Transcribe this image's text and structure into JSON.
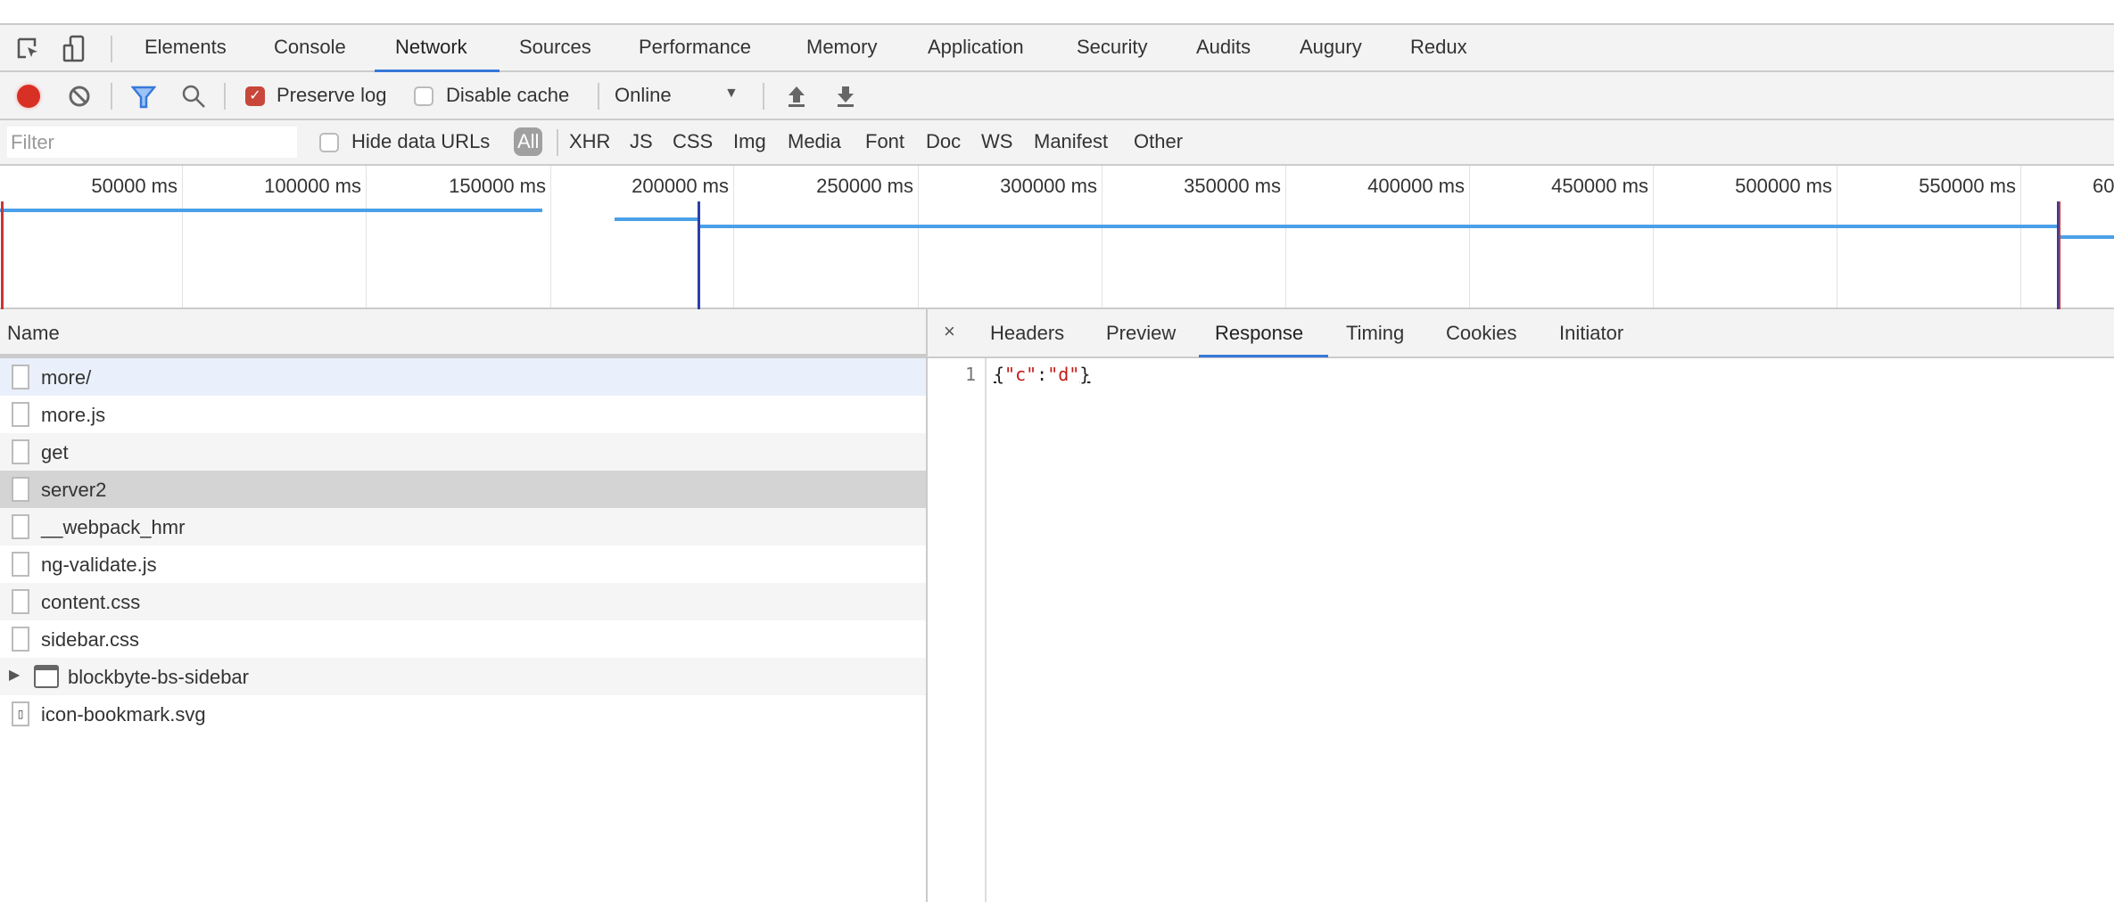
{
  "tabs": {
    "items": [
      "Elements",
      "Console",
      "Network",
      "Sources",
      "Performance",
      "Memory",
      "Application",
      "Security",
      "Audits",
      "Augury",
      "Redux"
    ],
    "active": "Network"
  },
  "toolbar": {
    "preserve_log": "Preserve log",
    "preserve_log_checked": true,
    "disable_cache": "Disable cache",
    "disable_cache_checked": false,
    "throttle": "Online",
    "record_color": "#d93025"
  },
  "filterbar": {
    "placeholder": "Filter",
    "hide_data_urls": "Hide data URLs",
    "types": [
      "All",
      "XHR",
      "JS",
      "CSS",
      "Img",
      "Media",
      "Font",
      "Doc",
      "WS",
      "Manifest",
      "Other"
    ],
    "active_type": "All"
  },
  "timeline": {
    "labels": [
      "50000 ms",
      "100000 ms",
      "150000 ms",
      "200000 ms",
      "250000 ms",
      "300000 ms",
      "350000 ms",
      "400000 ms",
      "450000 ms",
      "500000 ms",
      "550000 ms",
      "60"
    ]
  },
  "requests": {
    "header": "Name",
    "rows": [
      {
        "name": "more/",
        "icon": "document-icon"
      },
      {
        "name": "more.js",
        "icon": "script-icon"
      },
      {
        "name": "get",
        "icon": "file-icon"
      },
      {
        "name": "server2",
        "icon": "file-icon",
        "selected": true
      },
      {
        "name": "__webpack_hmr",
        "icon": "file-icon"
      },
      {
        "name": "ng-validate.js",
        "icon": "script-icon"
      },
      {
        "name": "content.css",
        "icon": "file-icon"
      },
      {
        "name": "sidebar.css",
        "icon": "file-icon"
      },
      {
        "name": "blockbyte-bs-sidebar",
        "icon": "frame-icon",
        "expandable": true
      },
      {
        "name": "icon-bookmark.svg",
        "icon": "image-icon"
      }
    ]
  },
  "detail": {
    "close": "×",
    "tabs": [
      "Headers",
      "Preview",
      "Response",
      "Timing",
      "Cookies",
      "Initiator"
    ],
    "active": "Response",
    "response": {
      "line_number": "1",
      "open": "{",
      "key": "\"c\"",
      "colon": ":",
      "value": "\"d\"",
      "close": "}"
    }
  }
}
